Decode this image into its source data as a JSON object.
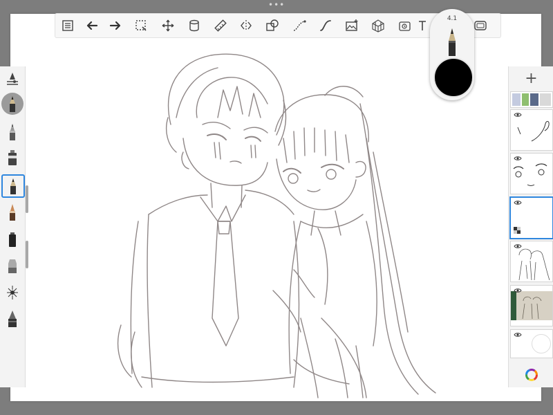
{
  "app": {
    "ellipsis": "•••"
  },
  "brush_puck": {
    "size_label": "4.1",
    "color": "#000000"
  },
  "toolbar": {
    "tools": [
      {
        "name": "layer-list-icon"
      },
      {
        "name": "undo-icon"
      },
      {
        "name": "redo-icon"
      },
      {
        "name": "selection-icon"
      },
      {
        "name": "transform-icon"
      },
      {
        "name": "fill-bucket-icon"
      },
      {
        "name": "ruler-icon"
      },
      {
        "name": "symmetry-icon"
      },
      {
        "name": "shape-icon"
      },
      {
        "name": "curve-stroke-icon"
      },
      {
        "name": "predictive-stroke-icon"
      },
      {
        "name": "image-import-icon"
      },
      {
        "name": "perspective-grid-icon"
      },
      {
        "name": "time-lapse-icon"
      },
      {
        "name": "text-icon"
      },
      {
        "name": "fullscreen-icon"
      }
    ]
  },
  "left_panel": {
    "items": [
      {
        "name": "brush-settings-icon",
        "selected": false
      },
      {
        "name": "current-brush-icon",
        "selected": false
      },
      {
        "name": "pencil-brush-icon",
        "selected": false
      },
      {
        "name": "airbrush-brush-icon",
        "selected": false
      },
      {
        "name": "paintbrush-brush-icon",
        "selected": true
      },
      {
        "name": "marker-brush-icon",
        "selected": false
      },
      {
        "name": "ink-brush-icon",
        "selected": false
      },
      {
        "name": "eraser-brush-icon",
        "selected": false
      },
      {
        "name": "smudge-brush-icon",
        "selected": false
      },
      {
        "name": "fill-brush-icon",
        "selected": false
      }
    ]
  },
  "layers": {
    "add_label": "+",
    "items": [
      {
        "name": "layer-color-strip",
        "visible": true,
        "selected": false
      },
      {
        "name": "layer-ear-sketch",
        "visible": true,
        "selected": false
      },
      {
        "name": "layer-eyes-sketch",
        "visible": true,
        "selected": false
      },
      {
        "name": "layer-empty",
        "visible": true,
        "selected": true
      },
      {
        "name": "layer-figures-sketch",
        "visible": true,
        "selected": false
      },
      {
        "name": "layer-photo-reference",
        "visible": true,
        "selected": false
      },
      {
        "name": "layer-background",
        "visible": true,
        "selected": false
      }
    ]
  },
  "colors": {
    "sketch_stroke": "#8f8787",
    "selection_blue": "#2e86de",
    "background": "#7d7d7d"
  }
}
